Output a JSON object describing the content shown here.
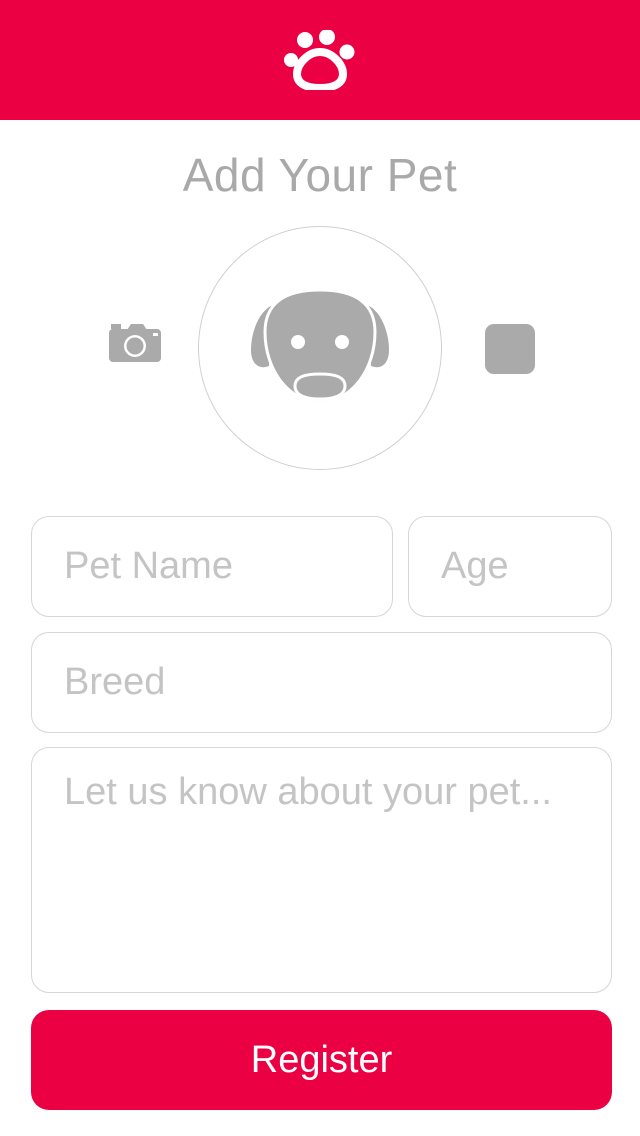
{
  "header": {
    "logo_icon": "paw-icon",
    "background": "#ec0044"
  },
  "page": {
    "title": "Add Your Pet"
  },
  "photo": {
    "camera_icon": "camera-icon",
    "avatar_icon": "dog-face-icon",
    "gallery_icon": "gallery-thumbnail-icon"
  },
  "form": {
    "pet_name_placeholder": "Pet Name",
    "age_placeholder": "Age",
    "breed_placeholder": "Breed",
    "about_placeholder": "Let us know about your pet..."
  },
  "actions": {
    "register_label": "Register"
  },
  "colors": {
    "accent": "#ec0044",
    "muted_text": "#a9a9a9",
    "border": "#d6d6d6",
    "icon_gray": "#aaaaaa"
  }
}
